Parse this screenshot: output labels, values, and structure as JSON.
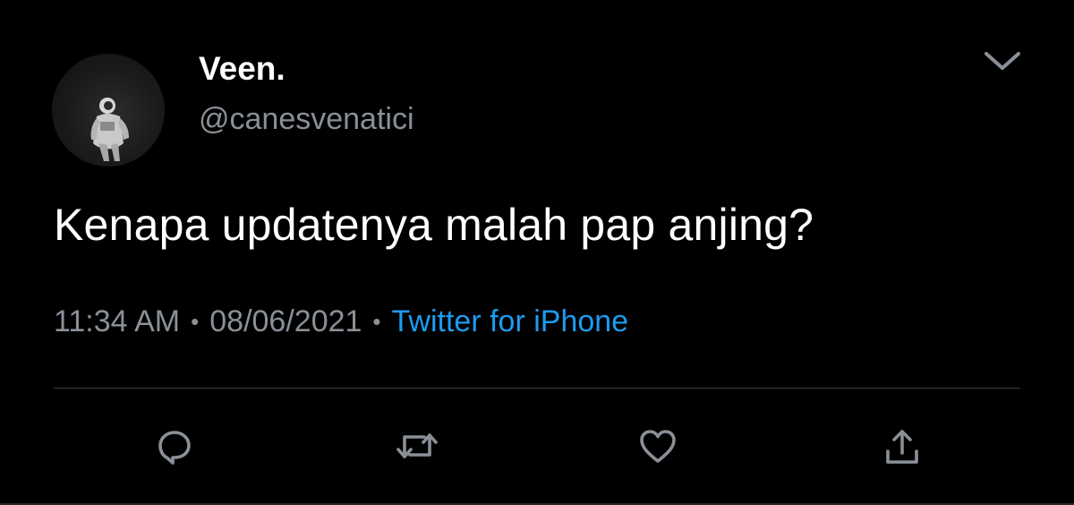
{
  "tweet": {
    "author": {
      "display_name": "Veen.",
      "handle": "@canesvenatici"
    },
    "text": "Kenapa updatenya malah pap anjing?",
    "time": "11:34 AM",
    "date": "08/06/2021",
    "separator": "•",
    "source": "Twitter for iPhone"
  },
  "actions": [
    {
      "name": "reply",
      "icon": "reply-icon"
    },
    {
      "name": "retweet",
      "icon": "retweet-icon"
    },
    {
      "name": "like",
      "icon": "heart-icon"
    },
    {
      "name": "share",
      "icon": "share-icon"
    }
  ],
  "colors": {
    "background": "#000000",
    "text": "#ffffff",
    "secondary": "#8a9097",
    "link": "#1d9bf0"
  }
}
